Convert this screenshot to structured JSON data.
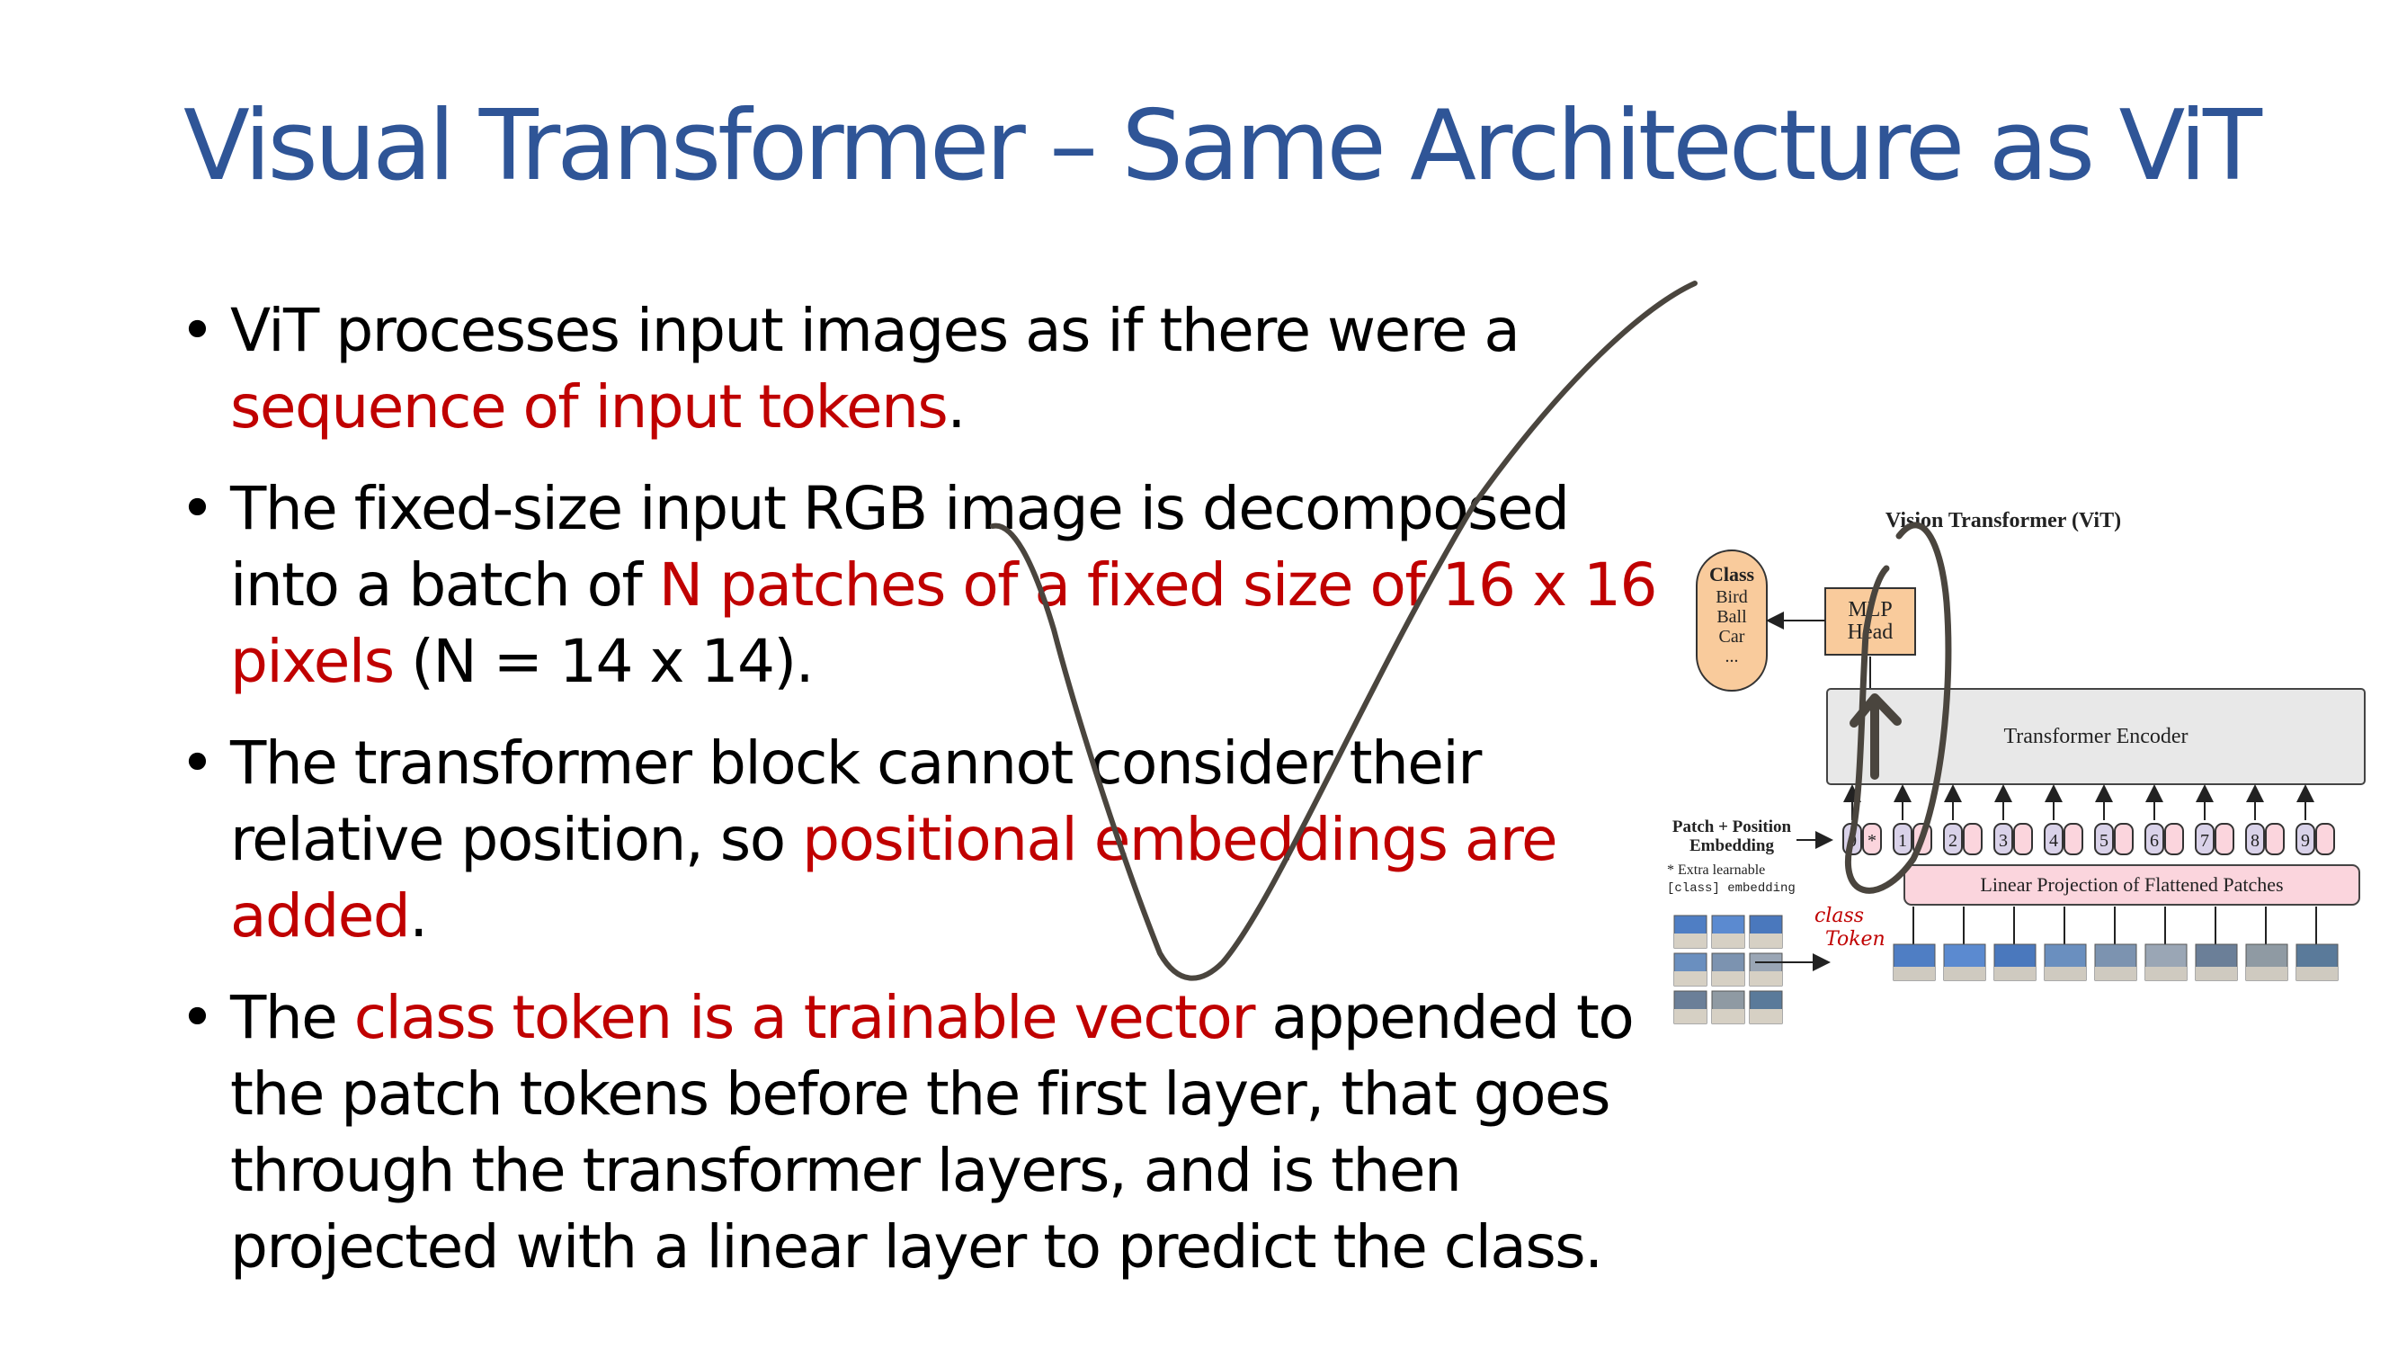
{
  "title": "Visual Transformer – Same Architecture as ViT",
  "bullets": [
    {
      "t1": "ViT processes input images as if there were a ",
      "r1": "sequence of input tokens",
      "t2": "."
    },
    {
      "t1": "The fixed-size input RGB image is decomposed into a batch of ",
      "r1": "N patches of a fixed size of 16 x 16 pixels",
      "t2": " (N = 14 x 14)."
    },
    {
      "t1": "The transformer block cannot consider their relative position, so ",
      "r1": "positional embeddings are added",
      "t2": "."
    },
    {
      "t1": "The ",
      "r1": "class token is a trainable vector",
      "t2": " appended to the patch tokens before the first layer, that goes through the transformer layers, and is then projected with a linear layer to predict the class."
    }
  ],
  "figure": {
    "title": "Vision Transformer (ViT)",
    "class_label": "Class",
    "class_items": [
      "Bird",
      "Ball",
      "Car",
      "..."
    ],
    "mlp_head": [
      "MLP",
      "Head"
    ],
    "encoder": "Transformer Encoder",
    "embedding_label": [
      "Patch + Position",
      "Embedding"
    ],
    "extra_note": [
      "* Extra learnable",
      "[class] embedding"
    ],
    "projection": "Linear Projection of Flattened Patches",
    "tokens": [
      "0",
      "1",
      "2",
      "3",
      "4",
      "5",
      "6",
      "7",
      "8",
      "9"
    ],
    "class_marker": "*",
    "handwritten_note": [
      "class",
      "Token"
    ]
  },
  "colors": {
    "title": "#2f5597",
    "highlight": "#c00000",
    "class_box": "#f9cb9c",
    "projection_box": "#fbd5dd",
    "token_box": "#d9d2e9",
    "encoder_box": "#e8e8e8",
    "ink": "#4a453e"
  }
}
